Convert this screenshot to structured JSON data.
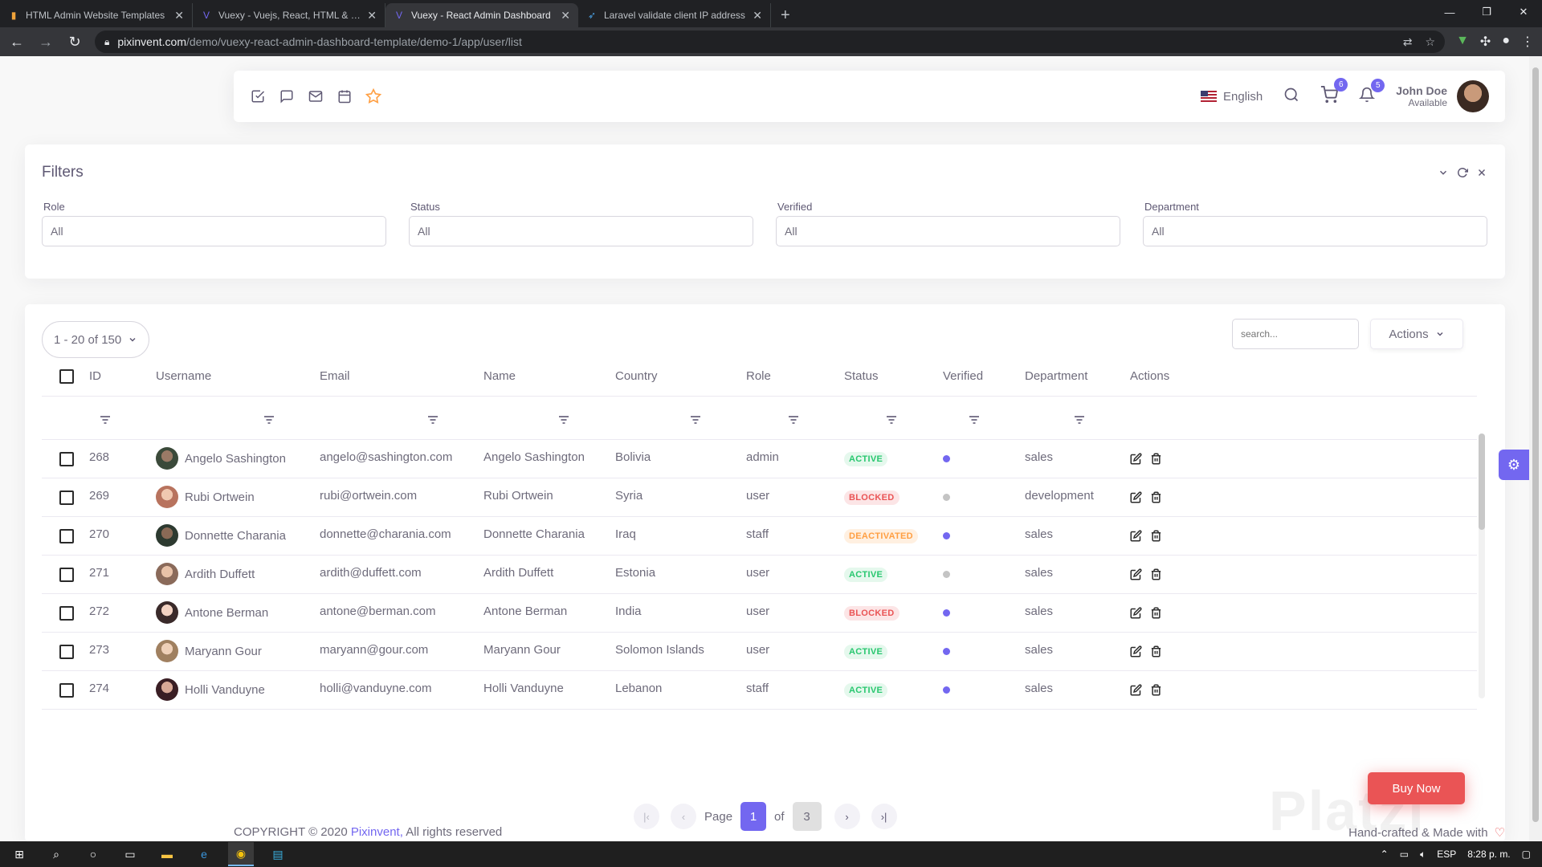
{
  "browser": {
    "tabs": [
      {
        "title": "HTML Admin Website Templates",
        "active": false
      },
      {
        "title": "Vuexy - Vuejs, React, HTML & Laravel",
        "active": false
      },
      {
        "title": "Vuexy - React Admin Dashboard",
        "active": true
      },
      {
        "title": "Laravel validate client IP address",
        "active": false
      }
    ],
    "url_host": "pixinvent.com",
    "url_path": "/demo/vuexy-react-admin-dashboard-template/demo-1/app/user/list"
  },
  "navbar": {
    "language": "English",
    "cart_count": "6",
    "notification_count": "5",
    "user_name": "John Doe",
    "user_status": "Available"
  },
  "filters": {
    "title": "Filters",
    "fields": [
      {
        "label": "Role",
        "value": "All"
      },
      {
        "label": "Status",
        "value": "All"
      },
      {
        "label": "Verified",
        "value": "All"
      },
      {
        "label": "Department",
        "value": "All"
      }
    ]
  },
  "list": {
    "per_page": "1 - 20 of 150",
    "search_placeholder": "search...",
    "actions_label": "Actions",
    "columns": [
      "ID",
      "Username",
      "Email",
      "Name",
      "Country",
      "Role",
      "Status",
      "Verified",
      "Department",
      "Actions"
    ],
    "rows": [
      {
        "id": "268",
        "username": "Angelo Sashington",
        "email": "angelo@sashington.com",
        "name": "Angelo Sashington",
        "country": "Bolivia",
        "role": "admin",
        "status": "ACTIVE",
        "verified": true,
        "department": "sales"
      },
      {
        "id": "269",
        "username": "Rubi Ortwein",
        "email": "rubi@ortwein.com",
        "name": "Rubi Ortwein",
        "country": "Syria",
        "role": "user",
        "status": "BLOCKED",
        "verified": false,
        "department": "development"
      },
      {
        "id": "270",
        "username": "Donnette Charania",
        "email": "donnette@charania.com",
        "name": "Donnette Charania",
        "country": "Iraq",
        "role": "staff",
        "status": "DEACTIVATED",
        "verified": true,
        "department": "sales"
      },
      {
        "id": "271",
        "username": "Ardith Duffett",
        "email": "ardith@duffett.com",
        "name": "Ardith Duffett",
        "country": "Estonia",
        "role": "user",
        "status": "ACTIVE",
        "verified": false,
        "department": "sales"
      },
      {
        "id": "272",
        "username": "Antone Berman",
        "email": "antone@berman.com",
        "name": "Antone Berman",
        "country": "India",
        "role": "user",
        "status": "BLOCKED",
        "verified": true,
        "department": "sales"
      },
      {
        "id": "273",
        "username": "Maryann Gour",
        "email": "maryann@gour.com",
        "name": "Maryann Gour",
        "country": "Solomon Islands",
        "role": "user",
        "status": "ACTIVE",
        "verified": true,
        "department": "sales"
      },
      {
        "id": "274",
        "username": "Holli Vanduyne",
        "email": "holli@vanduyne.com",
        "name": "Holli Vanduyne",
        "country": "Lebanon",
        "role": "staff",
        "status": "ACTIVE",
        "verified": true,
        "department": "sales"
      }
    ],
    "pagination": {
      "label": "Page",
      "current": "1",
      "of": "of",
      "total": "3"
    }
  },
  "buy_now": "Buy Now",
  "footer": {
    "copyright": "COPYRIGHT © 2020",
    "brand": "Pixinvent,",
    "rights": "All rights reserved",
    "made_with": "Hand-crafted & Made with"
  },
  "taskbar": {
    "lang": "ESP",
    "time": "8:28 p. m."
  },
  "colors": {
    "primary": "#7367f0",
    "success": "#28c76f",
    "danger": "#ea5455",
    "warning": "#ff9f43",
    "muted_dot": "#c4c4c4"
  }
}
